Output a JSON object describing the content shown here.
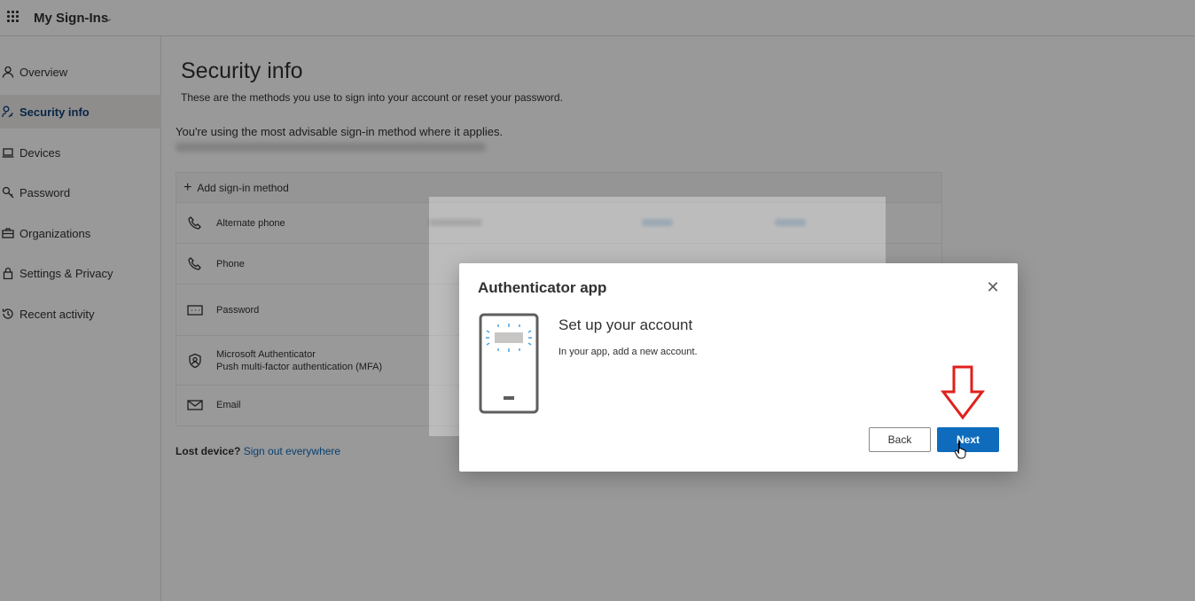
{
  "topbar": {
    "app_title": "My Sign-Ins",
    "chevron": "chevron-down-icon"
  },
  "sidebar": {
    "items": [
      {
        "label": "Overview",
        "icon": "person-icon",
        "active": false
      },
      {
        "label": "Security info",
        "icon": "security-key-icon",
        "active": true
      },
      {
        "label": "Devices",
        "icon": "laptop-icon",
        "active": false
      },
      {
        "label": "Password",
        "icon": "key-icon",
        "active": false
      },
      {
        "label": "Organizations",
        "icon": "briefcase-icon",
        "active": false
      },
      {
        "label": "Settings & Privacy",
        "icon": "lock-icon",
        "active": false
      },
      {
        "label": "Recent activity",
        "icon": "history-icon",
        "active": false
      }
    ]
  },
  "main": {
    "title": "Security info",
    "subtitle": "These are the methods you use to sign into your account or reset your password.",
    "advice": "You're using the most advisable sign-in method where it applies.",
    "add_method_label": "Add sign-in method",
    "methods": [
      {
        "icon": "phone-icon",
        "label": "Alternate phone",
        "sublabel": ""
      },
      {
        "icon": "phone-icon",
        "label": "Phone",
        "sublabel": ""
      },
      {
        "icon": "password-icon",
        "label": "Password",
        "sublabel": ""
      },
      {
        "icon": "authenticator-icon",
        "label": "Microsoft Authenticator",
        "sublabel": "Push multi-factor authentication (MFA)"
      },
      {
        "icon": "email-icon",
        "label": "Email",
        "sublabel": ""
      }
    ],
    "lost_device_label": "Lost device?",
    "sign_out_link": "Sign out everywhere"
  },
  "dialog": {
    "title": "Authenticator app",
    "heading": "Set up your account",
    "text": "In your app, add a new account.",
    "back_label": "Back",
    "next_label": "Next"
  },
  "colors": {
    "accent": "#0f6cbd",
    "annotation_arrow": "#e0201b"
  }
}
